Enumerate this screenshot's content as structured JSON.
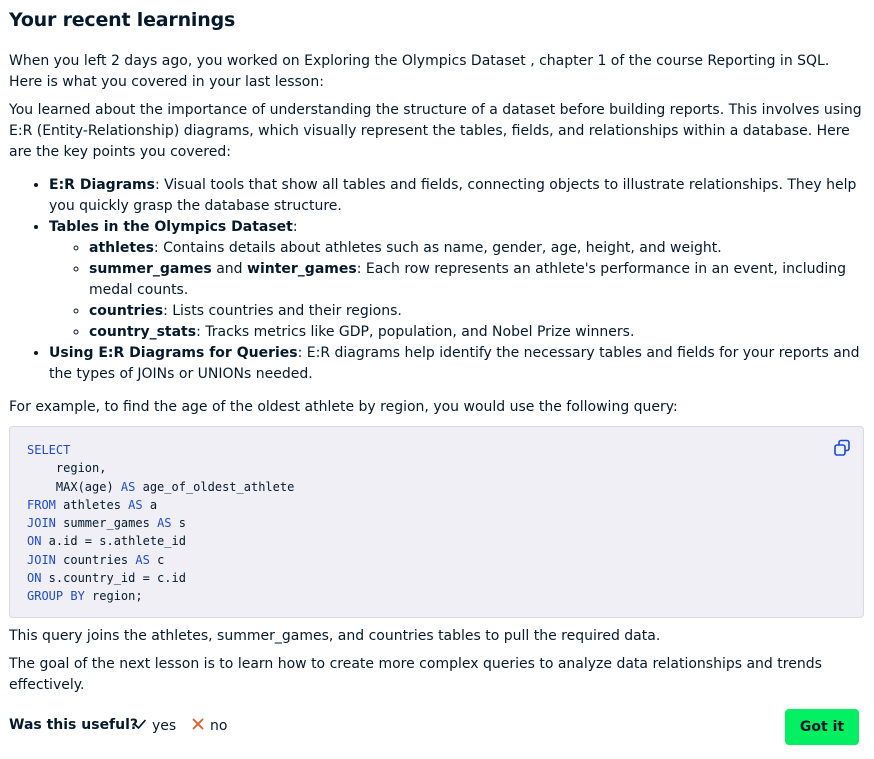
{
  "title": "Your recent learnings",
  "intro": "When you left 2 days ago, you worked on Exploring the Olympics Dataset , chapter 1 of the course Reporting in SQL. Here is what you covered in your last lesson:",
  "summary": "You learned about the importance of understanding the structure of a dataset before building reports. This involves using E:R (Entity-Relationship) diagrams, which visually represent the tables, fields, and relationships within a database. Here are the key points you covered:",
  "points": {
    "er": {
      "term": "E:R Diagrams",
      "text": ": Visual tools that show all tables and fields, connecting objects to illustrate relationships. They help you quickly grasp the database structure."
    },
    "tables": {
      "term": "Tables in the Olympics Dataset",
      "colon": ":",
      "items": {
        "athletes": {
          "term": "athletes",
          "text": ": Contains details about athletes such as name, gender, age, height, and weight."
        },
        "games": {
          "term1": "summer_games",
          "and": " and ",
          "term2": "winter_games",
          "text": ": Each row represents an athlete's performance in an event, including medal counts."
        },
        "countries": {
          "term": "countries",
          "text": ": Lists countries and their regions."
        },
        "country_stats": {
          "term": "country_stats",
          "text": ": Tracks metrics like GDP, population, and Nobel Prize winners."
        }
      }
    },
    "queries": {
      "term": "Using E:R Diagrams for Queries",
      "text": ": E:R diagrams help identify the necessary tables and fields for your reports and the types of JOINs or UNIONs needed."
    }
  },
  "example_intro": "For example, to find the age of the oldest athlete by region, you would use the following query:",
  "code": {
    "l1": {
      "kw": "SELECT"
    },
    "l2": {
      "rest": "    region,"
    },
    "l3": {
      "pre": "    MAX(age) ",
      "kw": "AS",
      "rest": " age_of_oldest_athlete"
    },
    "l4": {
      "kw": "FROM",
      "mid": " athletes ",
      "kw2": "AS",
      "rest": " a"
    },
    "l5": {
      "kw": "JOIN",
      "mid": " summer_games ",
      "kw2": "AS",
      "rest": " s"
    },
    "l6": {
      "kw": "ON",
      "rest": " a.id = s.athlete_id"
    },
    "l7": {
      "kw": "JOIN",
      "mid": " countries ",
      "kw2": "AS",
      "rest": " c"
    },
    "l8": {
      "kw": "ON",
      "rest": " s.country_id = c.id"
    },
    "l9": {
      "kw": "GROUP BY",
      "rest": " region;"
    }
  },
  "after_code": "This query joins the athletes, summer_games, and countries tables to pull the required data.",
  "next_goal": "The goal of the next lesson is to learn how to create more complex queries to analyze data relationships and trends effectively.",
  "feedback": {
    "question": "Was this useful?",
    "yes": "yes",
    "no": "no"
  },
  "got_it": "Got it",
  "colors": {
    "accent": "#03ef62",
    "keyword": "#1d4bd1",
    "no": "#e0582d",
    "text": "#05192d"
  },
  "icons": {
    "copy": "copy-icon",
    "yes": "check-icon",
    "no": "close-icon"
  }
}
